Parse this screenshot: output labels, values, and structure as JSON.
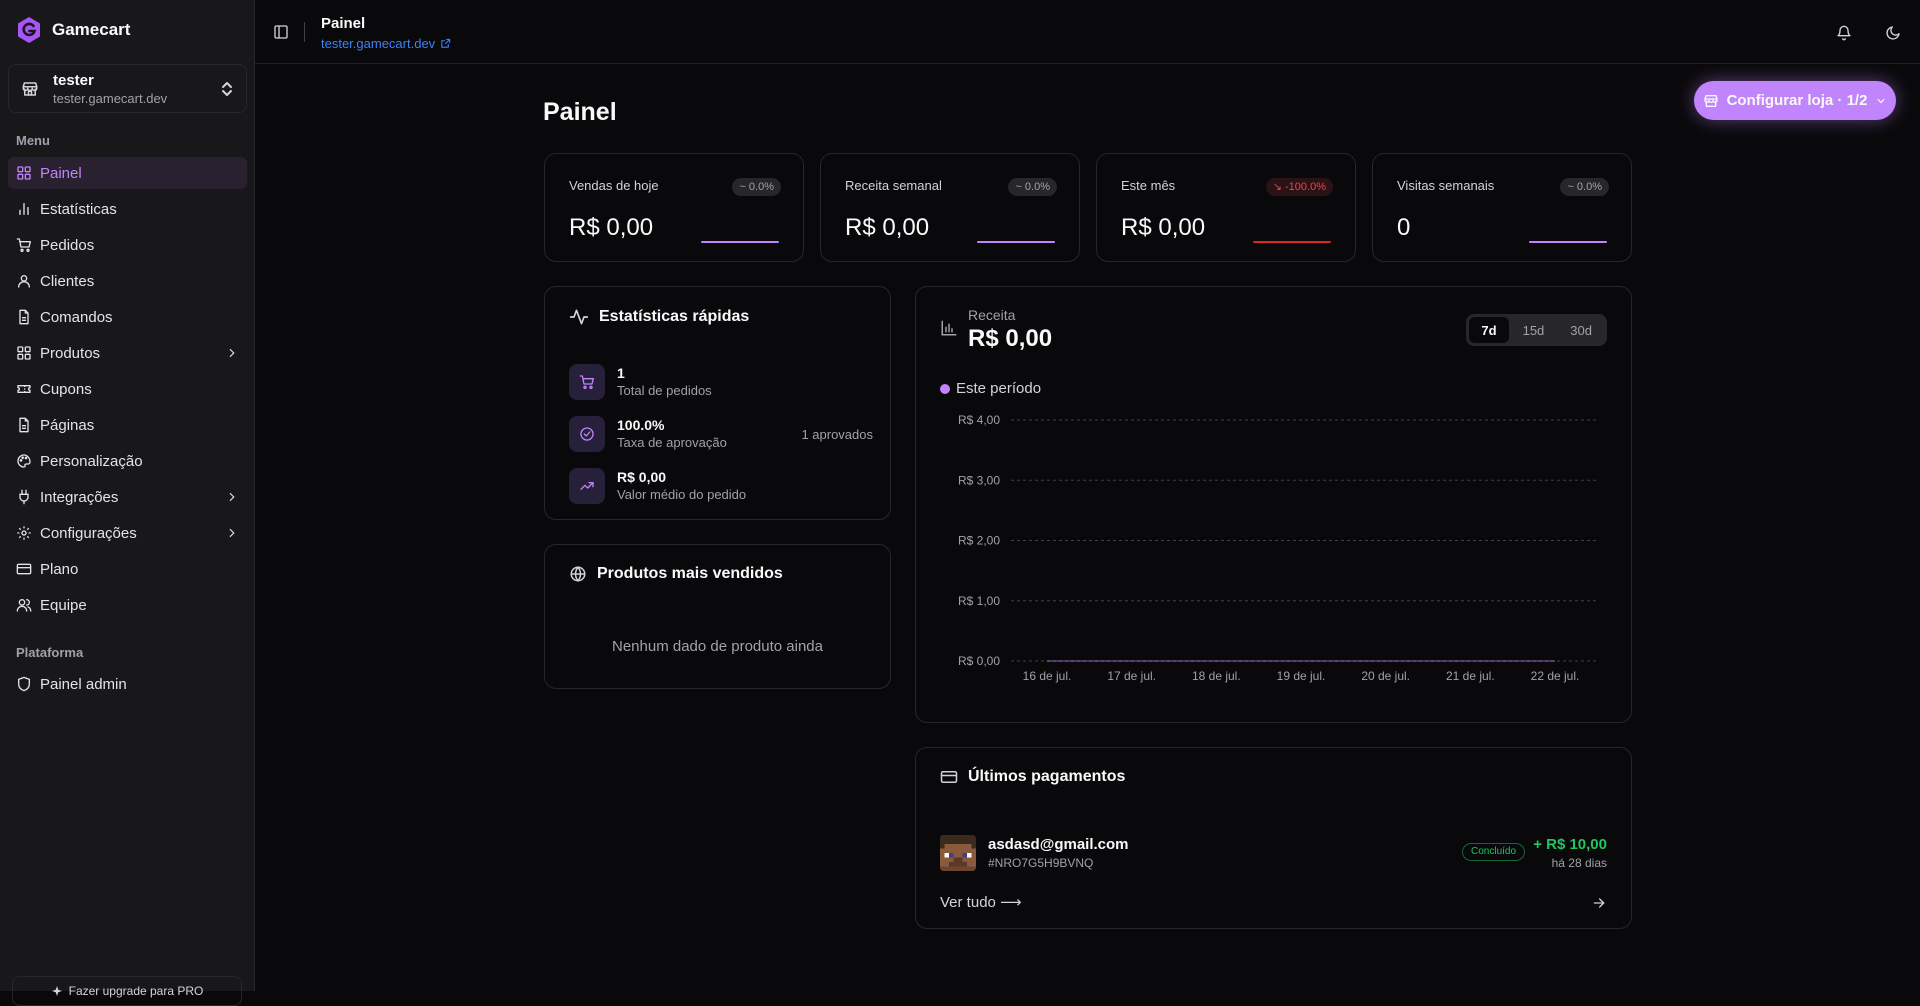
{
  "brand": {
    "name": "Gamecart",
    "accent": "#c084fc"
  },
  "store": {
    "name": "tester",
    "domain": "tester.gamecart.dev"
  },
  "sidebar": {
    "menu_label": "Menu",
    "items": [
      {
        "label": "Painel",
        "icon": "dashboard-icon",
        "active": true
      },
      {
        "label": "Estatísticas",
        "icon": "bar-chart-icon"
      },
      {
        "label": "Pedidos",
        "icon": "cart-icon"
      },
      {
        "label": "Clientes",
        "icon": "user-icon"
      },
      {
        "label": "Comandos",
        "icon": "file-icon"
      },
      {
        "label": "Produtos",
        "icon": "grid-icon",
        "has_children": true
      },
      {
        "label": "Cupons",
        "icon": "ticket-icon"
      },
      {
        "label": "Páginas",
        "icon": "file-icon"
      },
      {
        "label": "Personalização",
        "icon": "palette-icon"
      },
      {
        "label": "Integrações",
        "icon": "plug-icon",
        "has_children": true
      },
      {
        "label": "Configurações",
        "icon": "gear-icon",
        "has_children": true
      },
      {
        "label": "Plano",
        "icon": "credit-card-icon"
      },
      {
        "label": "Equipe",
        "icon": "users-icon"
      }
    ],
    "platform_label": "Plataforma",
    "platform_items": [
      {
        "label": "Painel admin",
        "icon": "shield-icon"
      }
    ],
    "upgrade_label": "Fazer upgrade para PRO"
  },
  "header": {
    "title": "Painel",
    "link": "tester.gamecart.dev"
  },
  "main": {
    "title": "Painel",
    "config_button": "Configurar loja · 1/2",
    "stats": [
      {
        "label": "Vendas de hoje",
        "value": "R$ 0,00",
        "change": "~ 0.0%",
        "negative": false
      },
      {
        "label": "Receita semanal",
        "value": "R$ 0,00",
        "change": "~ 0.0%",
        "negative": false
      },
      {
        "label": "Este mês",
        "value": "R$ 0,00",
        "change": "↘ -100.0%",
        "negative": true
      },
      {
        "label": "Visitas semanais",
        "value": "0",
        "change": "~ 0.0%",
        "negative": false
      }
    ],
    "quick_stats": {
      "title": "Estatísticas rápidas",
      "rows": [
        {
          "value": "1",
          "label": "Total de pedidos",
          "side": "",
          "icon": "cart-icon"
        },
        {
          "value": "100.0%",
          "label": "Taxa de aprovação",
          "side": "1 aprovados",
          "icon": "check-circle-icon"
        },
        {
          "value": "R$ 0,00",
          "label": "Valor médio do pedido",
          "side": "",
          "icon": "trending-up-icon"
        }
      ]
    },
    "top_products": {
      "title": "Produtos mais vendidos",
      "empty": "Nenhum dado de produto ainda"
    },
    "revenue": {
      "label": "Receita",
      "value": "R$ 0,00",
      "ranges": [
        "7d",
        "15d",
        "30d"
      ],
      "active_range": "7d",
      "legend": "Este período"
    },
    "payments": {
      "title": "Últimos pagamentos",
      "items": [
        {
          "email": "asdasd@gmail.com",
          "id": "#NRO7G5H9BVNQ",
          "status": "Concluído",
          "amount": "+ R$ 10,00",
          "time": "há 28 dias"
        }
      ],
      "see_all": "Ver tudo ⟶"
    }
  },
  "chart_data": {
    "type": "line",
    "title": "",
    "xlabel": "",
    "ylabel": "",
    "categories": [
      "16 de jul.",
      "17 de jul.",
      "18 de jul.",
      "19 de jul.",
      "20 de jul.",
      "21 de jul.",
      "22 de jul."
    ],
    "series": [
      {
        "name": "Este período",
        "values": [
          0,
          0,
          0,
          0,
          0,
          0,
          0
        ],
        "color": "#c084fc"
      }
    ],
    "yticks": [
      "R$ 0,00",
      "R$ 1,00",
      "R$ 2,00",
      "R$ 3,00",
      "R$ 4,00"
    ],
    "ylim": [
      0,
      4
    ],
    "grid": true
  }
}
